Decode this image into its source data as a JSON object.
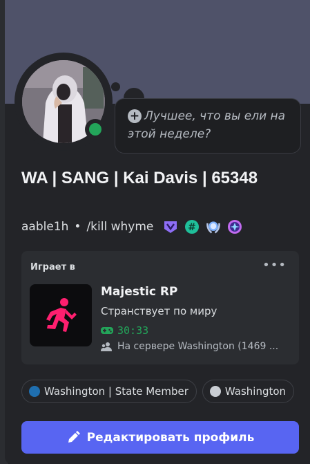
{
  "profile": {
    "display_name": "WA | SANG | Kai Davis | 65348",
    "username": "aable1h",
    "separator": "•",
    "custom_status": "/kill whyme",
    "online_status": "online",
    "status_prompt": "Лучшее, что вы ели на этой неделе?",
    "badges": [
      "nitro-badge",
      "hashtag-badge",
      "quest-laurel-badge",
      "hypesquad-badge"
    ]
  },
  "activity": {
    "header": "Играет в",
    "more": "•••",
    "game": "Majestic RP",
    "state": "Странствует по миру",
    "elapsed": "30:33",
    "server": "На сервере Washington (1469 ..."
  },
  "roles": [
    {
      "label": "Washington | State Member",
      "color": "#1f6fb0"
    },
    {
      "label": "Washington",
      "color": "#c9cdd3"
    }
  ],
  "edit_button": "Редактировать профиль",
  "colors": {
    "accent": "#5865f2",
    "online": "#23a55a",
    "banner": "#4f5269",
    "card": "#232428",
    "game_icon": "#ff1f6f"
  }
}
